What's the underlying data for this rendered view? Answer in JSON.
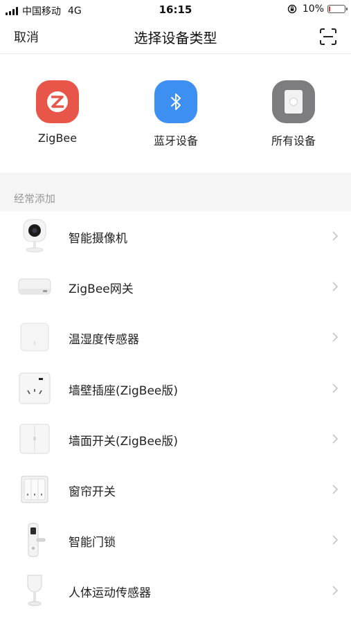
{
  "status_bar": {
    "carrier": "中国移动",
    "network": "4G",
    "time": "16:15",
    "battery": "10%",
    "battery_level": 0.1
  },
  "nav": {
    "cancel": "取消",
    "title": "选择设备类型"
  },
  "categories": [
    {
      "label": "ZigBee",
      "icon": "zigbee-icon",
      "color": "#e8564a"
    },
    {
      "label": "蓝牙设备",
      "icon": "bluetooth-icon",
      "color": "#3d8ff2"
    },
    {
      "label": "所有设备",
      "icon": "device-icon",
      "color": "#7d7d80"
    }
  ],
  "section": {
    "title": "经常添加"
  },
  "devices": [
    {
      "label": "智能摄像机",
      "icon": "camera-icon"
    },
    {
      "label": "ZigBee网关",
      "icon": "gateway-icon"
    },
    {
      "label": "温湿度传感器",
      "icon": "sensor-icon"
    },
    {
      "label": "墙壁插座(ZigBee版)",
      "icon": "wall-socket-icon"
    },
    {
      "label": "墙面开关(ZigBee版)",
      "icon": "wall-switch-icon"
    },
    {
      "label": "窗帘开关",
      "icon": "curtain-switch-icon"
    },
    {
      "label": "智能门锁",
      "icon": "door-lock-icon"
    },
    {
      "label": "人体运动传感器",
      "icon": "motion-sensor-icon"
    }
  ]
}
